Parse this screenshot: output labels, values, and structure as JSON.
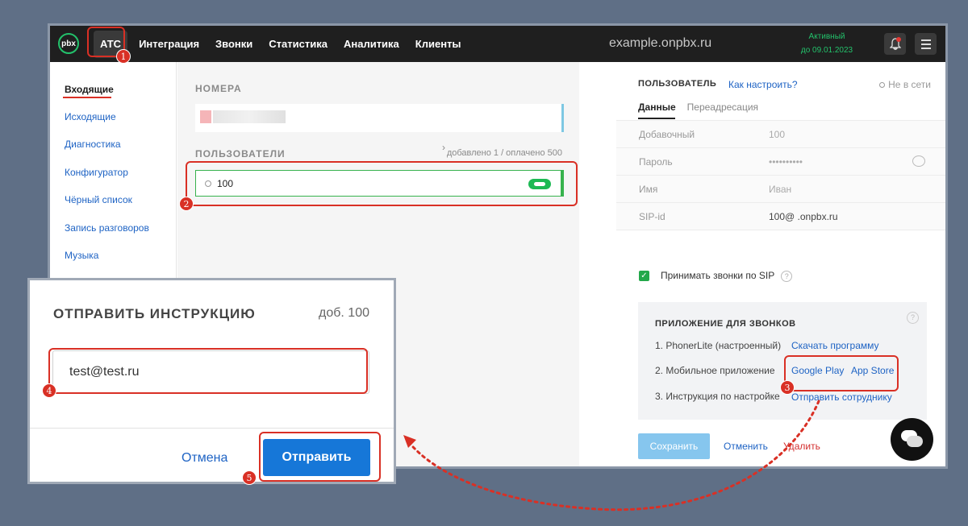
{
  "topbar": {
    "logo": "pbx",
    "nav": [
      "АТС",
      "Интеграция",
      "Звонки",
      "Статистика",
      "Аналитика",
      "Клиенты"
    ],
    "domain": "example.onpbx.ru",
    "status_line1": "Активный",
    "status_line2": "до 09.01.2023",
    "bell_icon": "bell-icon",
    "menu_icon": "hamburger-icon"
  },
  "sidebar": {
    "items": [
      "Входящие",
      "Исходящие",
      "Диагностика",
      "Конфигуратор",
      "Чёрный список",
      "Запись разговоров",
      "Музыка"
    ]
  },
  "middle": {
    "numbers_title": "НОМЕРА",
    "users_title": "ПОЛЬЗОВАТЕЛИ",
    "users_count": "добавлено 1 / оплачено 500",
    "user_number": "100"
  },
  "user_panel": {
    "title": "ПОЛЬЗОВАТЕЛЬ",
    "help_link": "Как настроить?",
    "status": "Не в сети",
    "tabs": [
      "Данные",
      "Переадресация"
    ],
    "fields": [
      {
        "label": "Добавочный",
        "value": "100"
      },
      {
        "label": "Пароль",
        "value": "••••••••••"
      },
      {
        "label": "Имя",
        "value": "Иван"
      },
      {
        "label": "SIP-id",
        "value": "100@         .onpbx.ru"
      }
    ],
    "sip_checkbox_label": "Принимать звонки по SIP",
    "app_section": {
      "title": "ПРИЛОЖЕНИЕ ДЛЯ ЗВОНКОВ",
      "row1": "1. PhonerLite (настроенный)",
      "row1_link": "Скачать программу",
      "row2": "2. Мобильное приложение",
      "row2_link1": "Google Play",
      "row2_link2": "App Store",
      "row3": "3. Инструкция по настройке",
      "row3_link": "Отправить сотруднику"
    },
    "save": "Сохранить",
    "cancel": "Отменить",
    "delete": "Удалить"
  },
  "popup": {
    "title": "ОТПРАВИТЬ ИНСТРУКЦИЮ",
    "ext": "доб. 100",
    "email_value": "test@test.ru",
    "cancel": "Отмена",
    "send": "Отправить"
  },
  "badges": [
    "1",
    "2",
    "3",
    "4",
    "5"
  ],
  "colors": {
    "accent": "#1677d8",
    "highlight": "#d93025",
    "success": "#23c16b"
  }
}
